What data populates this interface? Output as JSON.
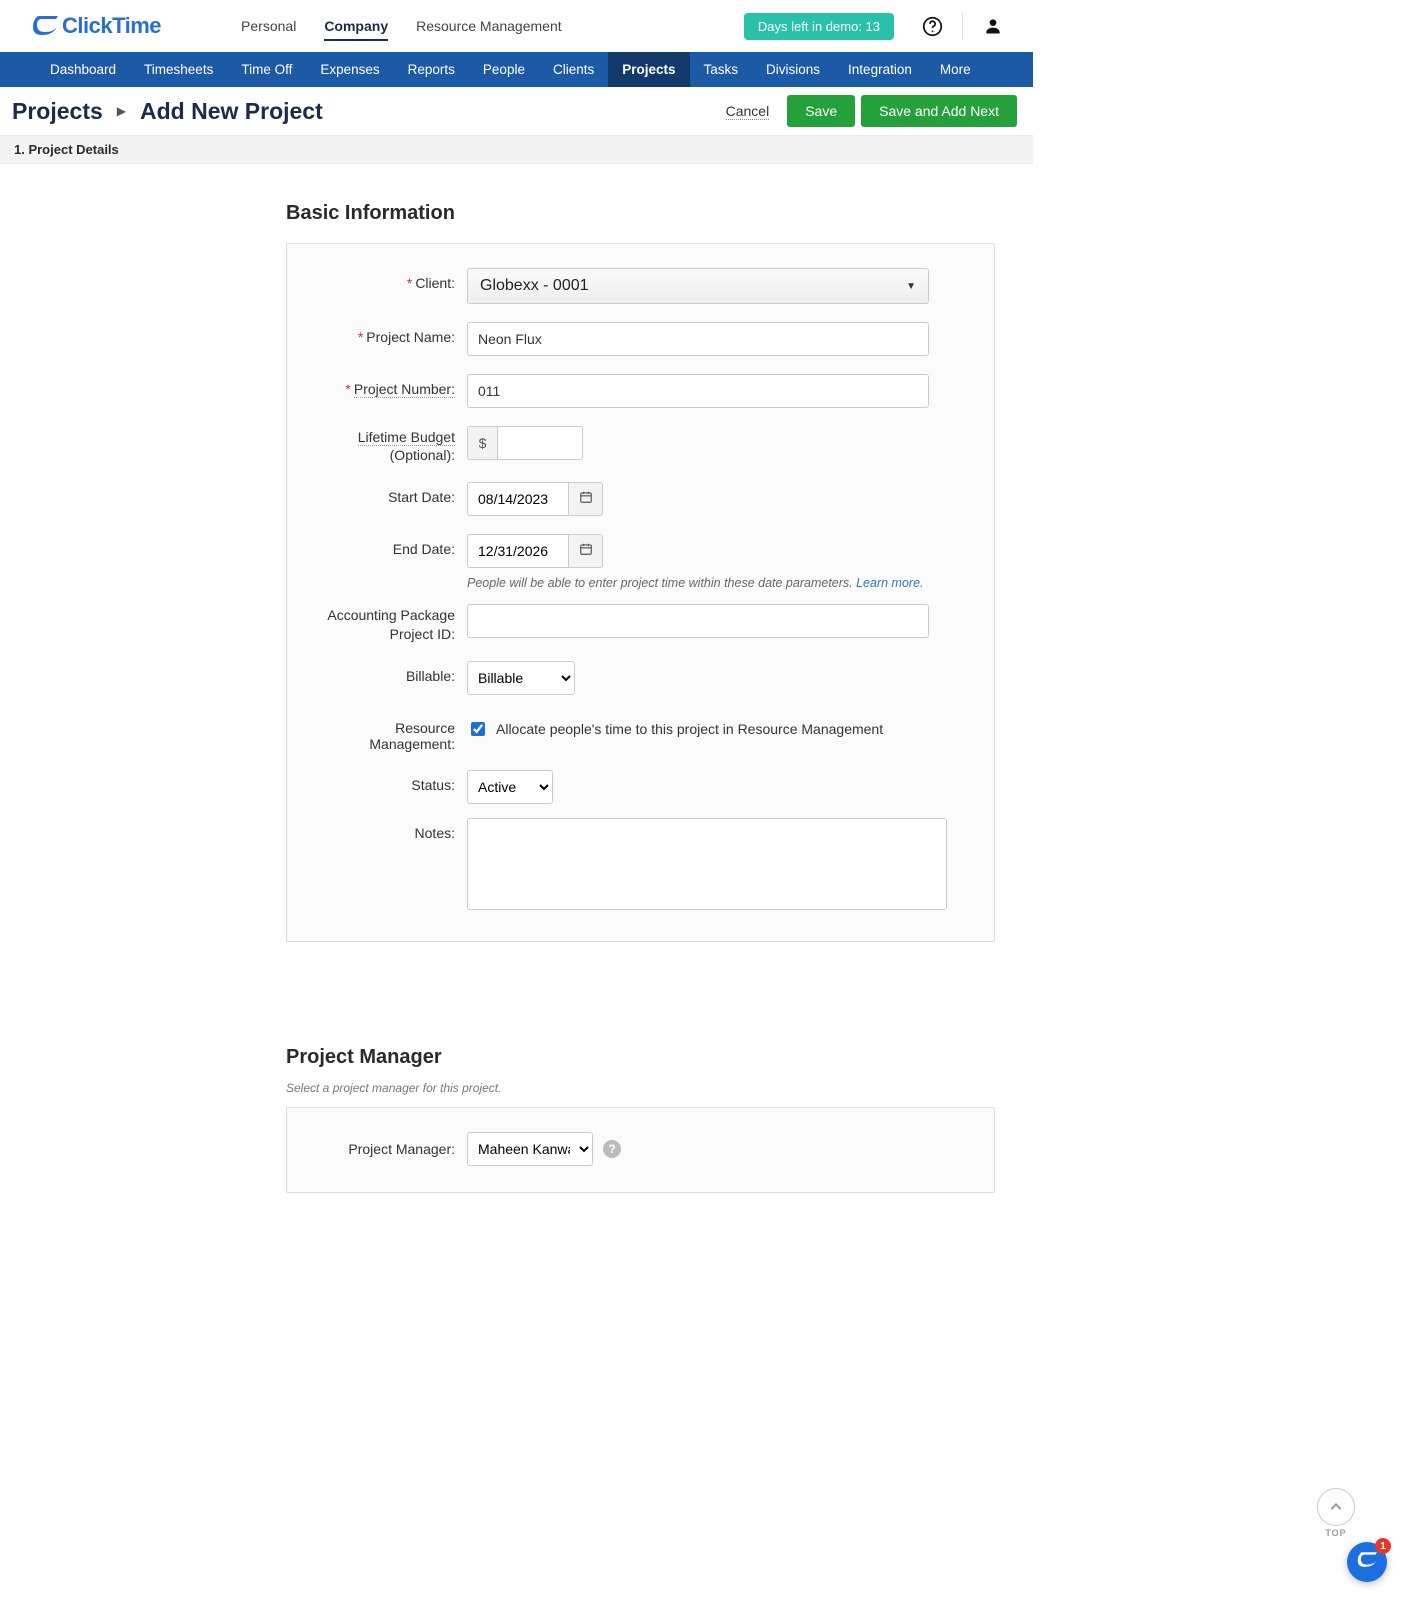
{
  "brand": "ClickTime",
  "topnav": {
    "items": [
      "Personal",
      "Company",
      "Resource Management"
    ],
    "active": 1
  },
  "demo_badge": "Days left in demo: 13",
  "mainnav": {
    "items": [
      "Dashboard",
      "Timesheets",
      "Time Off",
      "Expenses",
      "Reports",
      "People",
      "Clients",
      "Projects",
      "Tasks",
      "Divisions",
      "Integration",
      "More"
    ],
    "active": 7
  },
  "breadcrumb": {
    "root": "Projects",
    "leaf": "Add New Project"
  },
  "actions": {
    "cancel": "Cancel",
    "save": "Save",
    "save_next": "Save and Add Next"
  },
  "step_label": "1. Project Details",
  "sections": {
    "basic": {
      "title": "Basic Information",
      "labels": {
        "client": "Client:",
        "project_name": "Project Name:",
        "project_number": "Project Number:",
        "lifetime_budget": "Lifetime Budget",
        "lifetime_budget_suffix": "(Optional):",
        "start_date": "Start Date:",
        "end_date": "End Date:",
        "accounting_id": "Accounting Package Project ID:",
        "billable": "Billable:",
        "resource_mgmt": "Resource Management:",
        "status": "Status:",
        "notes": "Notes:"
      },
      "values": {
        "client": "Globexx - 0001",
        "project_name": "Neon Flux",
        "project_number": "011",
        "currency_symbol": "$",
        "lifetime_budget": "",
        "start_date": "08/14/2023",
        "end_date": "12/31/2026",
        "accounting_id": "",
        "billable": "Billable",
        "status": "Active",
        "notes": "",
        "resource_mgmt_checked": true,
        "resource_mgmt_text": "Allocate people's time to this project in Resource Management"
      },
      "hint_text": "People will be able to enter project time within these date parameters. ",
      "hint_link": "Learn more."
    },
    "pm": {
      "title": "Project Manager",
      "subtext": "Select a project manager for this project.",
      "label": "Project Manager:",
      "value": "Maheen Kanwal"
    }
  },
  "chat_badge": "1",
  "scroll_label": "TOP"
}
